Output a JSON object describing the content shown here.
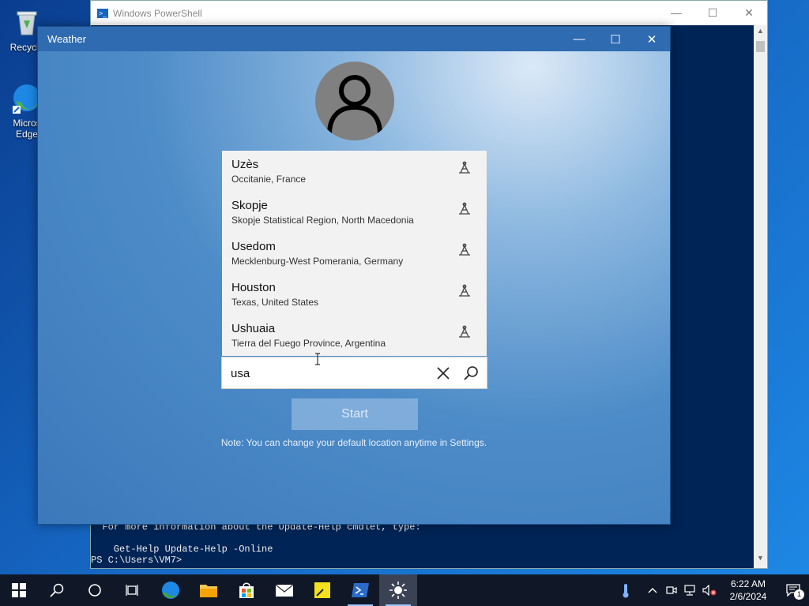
{
  "desktop": {
    "icons": [
      {
        "label": "Recycle",
        "icon": "recycle-bin-icon"
      },
      {
        "label": "Micros Edge",
        "icon": "edge-icon"
      }
    ]
  },
  "powershell": {
    "title": "Windows PowerShell",
    "lines": [
      "  For more information about the Update-Help cmdlet, type:",
      "",
      "    Get-Help Update-Help -Online",
      "PS C:\\Users\\VM7>"
    ]
  },
  "weather": {
    "title": "Weather",
    "suggestions": [
      {
        "city": "Uzès",
        "region": "Occitanie, France"
      },
      {
        "city": "Skopje",
        "region": "Skopje Statistical Region, North Macedonia"
      },
      {
        "city": "Usedom",
        "region": "Mecklenburg-West Pomerania, Germany"
      },
      {
        "city": "Houston",
        "region": "Texas, United States"
      },
      {
        "city": "Ushuaia",
        "region": "Tierra del Fuego Province, Argentina"
      }
    ],
    "search_value": "usa",
    "start_label": "Start",
    "note": "Note: You can change your default location anytime in Settings."
  },
  "taskbar": {
    "apps": [
      "start",
      "search",
      "cortana",
      "task-view",
      "edge",
      "file-explorer",
      "store",
      "mail",
      "sticky-notes",
      "powershell",
      "weather"
    ],
    "clock_time": "6:22 AM",
    "clock_date": "2/6/2024",
    "notification_count": "1"
  },
  "colors": {
    "weather_title": "#2f6bb0",
    "powershell_bg": "#012456",
    "taskbar_bg": "#101827"
  }
}
